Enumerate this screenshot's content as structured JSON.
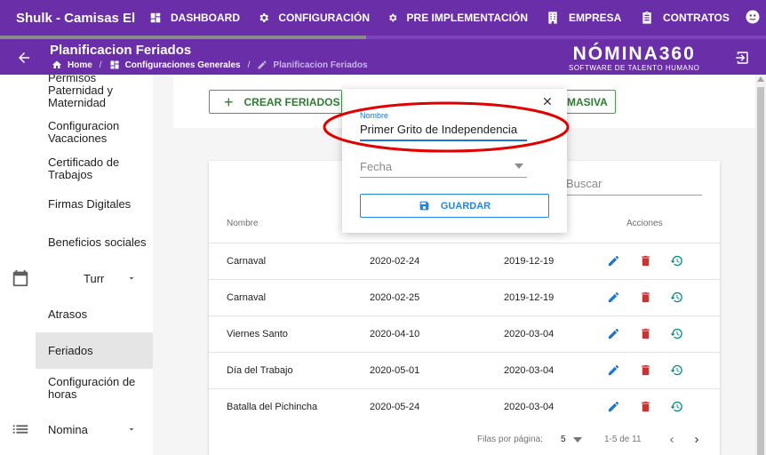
{
  "app": {
    "title": "Shulk - Camisas El"
  },
  "nav": [
    {
      "label": "DASHBOARD",
      "icon": "dashboard-icon"
    },
    {
      "label": "CONFIGURACIÓN",
      "icon": "gear-icon"
    },
    {
      "label": "PRE IMPLEMENTACIÓN",
      "icon": "gear-icon"
    },
    {
      "label": "EMPRESA",
      "icon": "building-icon"
    },
    {
      "label": "CONTRATOS",
      "icon": "clipboard-icon"
    }
  ],
  "header": {
    "title": "Planificacion Feriados",
    "breadcrumb": {
      "home": "Home",
      "parent": "Configuraciones Generales",
      "current": "Planificacion Feriados"
    },
    "logo": {
      "main": "NÓMINA360",
      "tagline": "SOFTWARE DE TALENTO HUMANO"
    }
  },
  "sidebar": {
    "items": [
      {
        "label": "Permisos Paternidad y Maternidad"
      },
      {
        "label": "Configuracion Vacaciones"
      },
      {
        "label": "Certificado de Trabajos"
      },
      {
        "label": "Firmas Digitales"
      },
      {
        "label": "Beneficios sociales"
      },
      {
        "label": "Atrasos"
      },
      {
        "label": "Feriados"
      },
      {
        "label": "Configuración de horas"
      }
    ],
    "groups": [
      {
        "label": "Turr",
        "icon": "calendar-icon"
      },
      {
        "label": "Nomina",
        "icon": "list-icon"
      }
    ]
  },
  "toolbar": {
    "create_label": "CREAR FERIADOS",
    "masiva_label": "MASIVA"
  },
  "table": {
    "search_placeholder": "Buscar",
    "headers": {
      "name": "Nombre",
      "actions": "Acciones"
    },
    "rows": [
      {
        "name": "Carnaval",
        "date": "2020-02-24",
        "created": "2019-12-19"
      },
      {
        "name": "Carnaval",
        "date": "2020-02-25",
        "created": "2019-12-19"
      },
      {
        "name": "Viernes Santo",
        "date": "2020-04-10",
        "created": "2020-03-04"
      },
      {
        "name": "Día del Trabajo",
        "date": "2020-05-01",
        "created": "2020-03-04"
      },
      {
        "name": "Batalla del Pichincha",
        "date": "2020-05-24",
        "created": "2020-03-04"
      }
    ],
    "pagination": {
      "rows_label": "Filas por página:",
      "rows_value": "5",
      "range": "1-5 de 11"
    }
  },
  "dialog": {
    "name_label": "Nombre",
    "name_value": "Primer Grito de Independencia",
    "date_placeholder": "Fecha",
    "save_label": "GUARDAR"
  },
  "colors": {
    "primary": "#6a2fa8",
    "green": "#43a047",
    "blue": "#1976d2",
    "red": "#d32f2f",
    "teal": "#00897b",
    "annotation": "#e00000"
  }
}
